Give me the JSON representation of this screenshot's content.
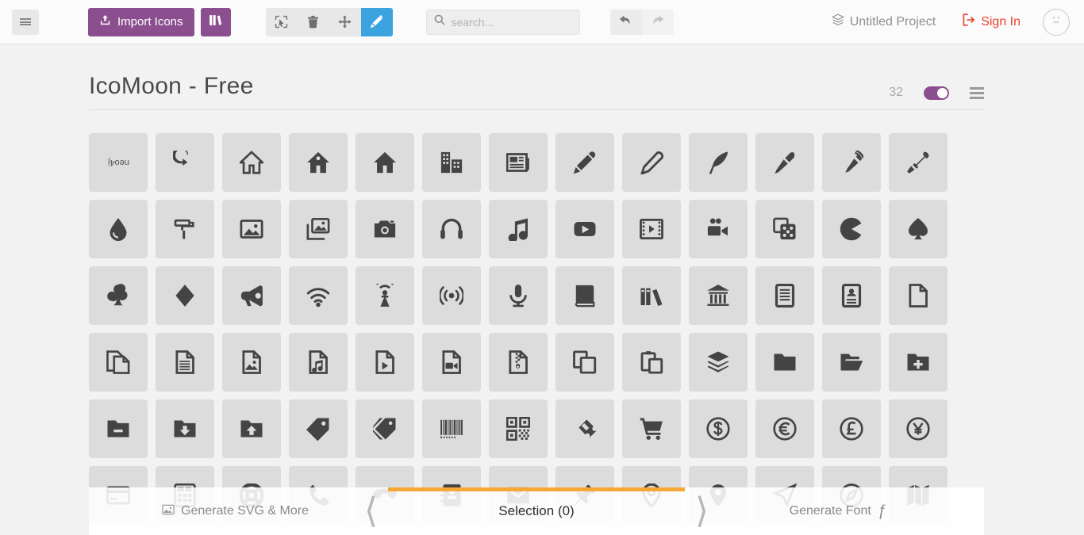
{
  "toolbar": {
    "menu_button": "menu",
    "import_label": "Import Icons",
    "library_button": "library",
    "tools": [
      {
        "name": "select-tool",
        "label": "Select",
        "active": false
      },
      {
        "name": "delete-tool",
        "label": "Delete",
        "active": false
      },
      {
        "name": "move-tool",
        "label": "Move",
        "active": false
      },
      {
        "name": "edit-tool",
        "label": "Edit",
        "active": true
      }
    ],
    "search": {
      "value": "",
      "placeholder": "search..."
    },
    "undo_label": "Undo",
    "redo_label": "Redo",
    "project_name": "Untitled Project",
    "sign_in_label": "Sign In",
    "avatar_label": "account"
  },
  "set": {
    "title": "IcoMoon - Free",
    "icon_count": "32",
    "toggle_on": true,
    "menu_label": "set menu"
  },
  "colors": {
    "purple": "#8b4f8f",
    "blue_active": "#3ba3e0",
    "orange": "#f5a833",
    "red": "#e8412b",
    "cell_bg": "#dcdcdc",
    "page_bg": "#f2f2f2"
  },
  "footer": {
    "generate_svg_label": "Generate SVG & More",
    "selection_label": "Selection (0)",
    "generate_font_label": "Generate Font",
    "prev_label": "previous",
    "next_label": "next"
  },
  "icons": [
    {
      "name": "neo4j-text-icon",
      "glyph": "text",
      "label": "neo4j"
    },
    {
      "name": "arrow-curve-icon",
      "glyph": "arrow-curve"
    },
    {
      "name": "home-icon",
      "glyph": "home"
    },
    {
      "name": "home2-icon",
      "glyph": "home2"
    },
    {
      "name": "home3-icon",
      "glyph": "home3"
    },
    {
      "name": "office-icon",
      "glyph": "office"
    },
    {
      "name": "newspaper-icon",
      "glyph": "newspaper"
    },
    {
      "name": "pencil-icon",
      "glyph": "pencil"
    },
    {
      "name": "pencil2-icon",
      "glyph": "pencil2"
    },
    {
      "name": "quill-icon",
      "glyph": "quill"
    },
    {
      "name": "pen-icon",
      "glyph": "pen"
    },
    {
      "name": "pen2-icon",
      "glyph": "pen2"
    },
    {
      "name": "eyedropper-icon",
      "glyph": "eyedropper"
    },
    {
      "name": "droplet-icon",
      "glyph": "droplet"
    },
    {
      "name": "paint-format-icon",
      "glyph": "paint-format"
    },
    {
      "name": "image-icon",
      "glyph": "image"
    },
    {
      "name": "images-icon",
      "glyph": "images"
    },
    {
      "name": "camera-icon",
      "glyph": "camera"
    },
    {
      "name": "headphones-icon",
      "glyph": "headphones"
    },
    {
      "name": "music-icon",
      "glyph": "music"
    },
    {
      "name": "play-icon",
      "glyph": "play"
    },
    {
      "name": "film-icon",
      "glyph": "film"
    },
    {
      "name": "video-camera-icon",
      "glyph": "video-camera"
    },
    {
      "name": "dice-icon",
      "glyph": "dice"
    },
    {
      "name": "pacman-icon",
      "glyph": "pacman"
    },
    {
      "name": "spades-icon",
      "glyph": "spades"
    },
    {
      "name": "clubs-icon",
      "glyph": "clubs"
    },
    {
      "name": "diamonds-icon",
      "glyph": "diamonds"
    },
    {
      "name": "bullhorn-icon",
      "glyph": "bullhorn"
    },
    {
      "name": "connection-icon",
      "glyph": "connection"
    },
    {
      "name": "podcast-icon",
      "glyph": "podcast"
    },
    {
      "name": "feed-icon",
      "glyph": "feed"
    },
    {
      "name": "mic-icon",
      "glyph": "mic"
    },
    {
      "name": "book-icon",
      "glyph": "book"
    },
    {
      "name": "books-icon",
      "glyph": "books"
    },
    {
      "name": "library-icon",
      "glyph": "library"
    },
    {
      "name": "file-text-icon",
      "glyph": "file-text"
    },
    {
      "name": "profile-icon",
      "glyph": "profile"
    },
    {
      "name": "file-empty-icon",
      "glyph": "file-empty"
    },
    {
      "name": "files-empty-icon",
      "glyph": "files-empty"
    },
    {
      "name": "file-text2-icon",
      "glyph": "file-text2"
    },
    {
      "name": "file-picture-icon",
      "glyph": "file-picture"
    },
    {
      "name": "file-music-icon",
      "glyph": "file-music"
    },
    {
      "name": "file-play-icon",
      "glyph": "file-play"
    },
    {
      "name": "file-video-icon",
      "glyph": "file-video"
    },
    {
      "name": "file-zip-icon",
      "glyph": "file-zip"
    },
    {
      "name": "copy-icon",
      "glyph": "copy"
    },
    {
      "name": "paste-icon",
      "glyph": "paste"
    },
    {
      "name": "stack-icon",
      "glyph": "stack"
    },
    {
      "name": "folder-icon",
      "glyph": "folder"
    },
    {
      "name": "folder-open-icon",
      "glyph": "folder-open"
    },
    {
      "name": "folder-plus-icon",
      "glyph": "folder-plus"
    },
    {
      "name": "folder-minus-icon",
      "glyph": "folder-minus"
    },
    {
      "name": "folder-download-icon",
      "glyph": "folder-download"
    },
    {
      "name": "folder-upload-icon",
      "glyph": "folder-upload"
    },
    {
      "name": "price-tag-icon",
      "glyph": "price-tag"
    },
    {
      "name": "price-tags-icon",
      "glyph": "price-tags"
    },
    {
      "name": "barcode-icon",
      "glyph": "barcode"
    },
    {
      "name": "qrcode-icon",
      "glyph": "qrcode"
    },
    {
      "name": "ticket-icon",
      "glyph": "ticket"
    },
    {
      "name": "cart-icon",
      "glyph": "cart"
    },
    {
      "name": "coin-dollar-icon",
      "glyph": "coin-dollar"
    },
    {
      "name": "coin-euro-icon",
      "glyph": "coin-euro"
    },
    {
      "name": "coin-pound-icon",
      "glyph": "coin-pound"
    },
    {
      "name": "coin-yen-icon",
      "glyph": "coin-yen"
    },
    {
      "name": "credit-card-icon",
      "glyph": "credit-card"
    },
    {
      "name": "calculator-icon",
      "glyph": "calculator"
    },
    {
      "name": "lifebuoy-icon",
      "glyph": "lifebuoy"
    },
    {
      "name": "phone-icon",
      "glyph": "phone"
    },
    {
      "name": "phone-hang-up-icon",
      "glyph": "phone-hang-up"
    },
    {
      "name": "address-book-icon",
      "glyph": "address-book"
    },
    {
      "name": "envelop-icon",
      "glyph": "envelop"
    },
    {
      "name": "pushpin-icon",
      "glyph": "pushpin"
    },
    {
      "name": "location-icon",
      "glyph": "location"
    },
    {
      "name": "location2-icon",
      "glyph": "location2"
    },
    {
      "name": "compass-icon",
      "glyph": "compass"
    },
    {
      "name": "compass2-icon",
      "glyph": "compass2"
    },
    {
      "name": "map-icon",
      "glyph": "map"
    }
  ]
}
